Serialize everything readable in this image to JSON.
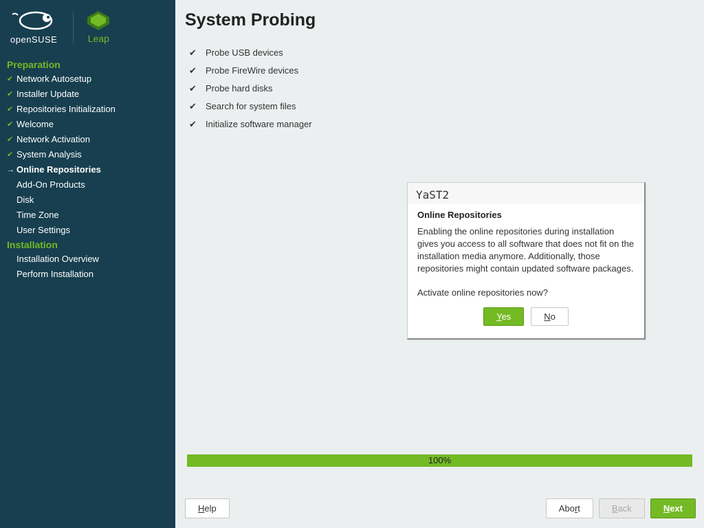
{
  "brand": {
    "name": "openSUSE",
    "variant": "Leap"
  },
  "sidebar": {
    "sections": [
      {
        "title": "Preparation"
      },
      {
        "title": "Installation"
      }
    ],
    "prep_items": [
      {
        "label": "Network Autosetup",
        "state": "done"
      },
      {
        "label": "Installer Update",
        "state": "done"
      },
      {
        "label": "Repositories Initialization",
        "state": "done"
      },
      {
        "label": "Welcome",
        "state": "done"
      },
      {
        "label": "Network Activation",
        "state": "done"
      },
      {
        "label": "System Analysis",
        "state": "done"
      },
      {
        "label": "Online Repositories",
        "state": "current"
      },
      {
        "label": "Add-On Products",
        "state": ""
      },
      {
        "label": "Disk",
        "state": ""
      },
      {
        "label": "Time Zone",
        "state": ""
      },
      {
        "label": "User Settings",
        "state": ""
      }
    ],
    "install_items": [
      {
        "label": "Installation Overview",
        "state": ""
      },
      {
        "label": "Perform Installation",
        "state": ""
      }
    ]
  },
  "main": {
    "title": "System Probing",
    "probes": [
      {
        "label": "Probe USB devices"
      },
      {
        "label": "Probe FireWire devices"
      },
      {
        "label": "Probe hard disks"
      },
      {
        "label": "Search for system files"
      },
      {
        "label": "Initialize software manager"
      }
    ],
    "progress_text": "100%"
  },
  "dialog": {
    "window_title": "YaST2",
    "heading": "Online Repositories",
    "body": "Enabling the online repositories during installation gives you access to all software that does not fit on the installation media anymore. Additionally, those repositories might contain updated software packages.",
    "question": "Activate online repositories now?",
    "yes": "Yes",
    "no": "No"
  },
  "buttons": {
    "help": "Help",
    "abort": "Abort",
    "back": "Back",
    "next": "Next"
  }
}
